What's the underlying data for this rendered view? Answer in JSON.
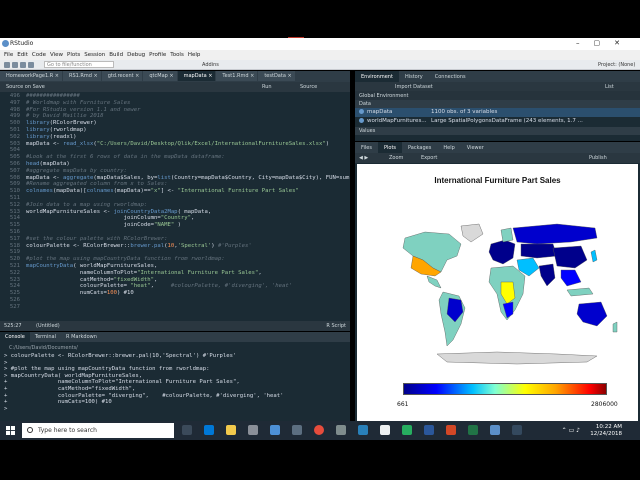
{
  "window": {
    "app_title": "RStudio"
  },
  "menu": [
    "File",
    "Edit",
    "Code",
    "View",
    "Plots",
    "Session",
    "Build",
    "Debug",
    "Profile",
    "Tools",
    "Help"
  ],
  "toolbar": {
    "goto_placeholder": "Go to file/function",
    "addins": "Addins",
    "project": "Project: (None)"
  },
  "editor": {
    "tabs": [
      "HomeworkPage1.R",
      "RS1.Rmd",
      "gtd.recent",
      "qtcMap",
      "mapData",
      "Test1.Rmd",
      "testData"
    ],
    "run_label": "Run",
    "source_label": "Source",
    "source_on_save": "Source on Save",
    "lines": [
      {
        "n": "496",
        "segs": [
          {
            "t": "################",
            "c": "c-comment"
          }
        ]
      },
      {
        "n": "497",
        "segs": [
          {
            "t": "# Worldmap with Furniture Sales",
            "c": "c-comment"
          }
        ]
      },
      {
        "n": "498",
        "segs": [
          {
            "t": "#For RStudio version 1.1 and newer",
            "c": "c-comment"
          }
        ]
      },
      {
        "n": "499",
        "segs": [
          {
            "t": "# by David Maillie 2018",
            "c": "c-comment"
          }
        ]
      },
      {
        "n": "500",
        "segs": [
          {
            "t": "library",
            "c": "c-fn"
          },
          {
            "t": "(RColorBrewer)",
            "c": "c-plain"
          }
        ]
      },
      {
        "n": "501",
        "segs": [
          {
            "t": "library",
            "c": "c-fn"
          },
          {
            "t": "(rworldmap)",
            "c": "c-plain"
          }
        ]
      },
      {
        "n": "502",
        "segs": [
          {
            "t": "library",
            "c": "c-fn"
          },
          {
            "t": "(readxl)",
            "c": "c-plain"
          }
        ]
      },
      {
        "n": "503",
        "segs": [
          {
            "t": "mapData <- ",
            "c": "c-plain"
          },
          {
            "t": "read_xlsx",
            "c": "c-fn"
          },
          {
            "t": "(",
            "c": "c-plain"
          },
          {
            "t": "\"C:/Users/David/Desktop/Qlik/Excel/InternationalFurnitureSales.xlsx\"",
            "c": "c-str"
          },
          {
            "t": ")",
            "c": "c-plain"
          }
        ]
      },
      {
        "n": "504",
        "segs": [
          {
            "t": "",
            "c": "c-plain"
          }
        ]
      },
      {
        "n": "505",
        "segs": [
          {
            "t": "#Look at the first 6 rows of data in the mapData dataframe:",
            "c": "c-comment"
          }
        ]
      },
      {
        "n": "506",
        "segs": [
          {
            "t": "head",
            "c": "c-fn"
          },
          {
            "t": "(mapData)",
            "c": "c-plain"
          }
        ]
      },
      {
        "n": "507",
        "segs": [
          {
            "t": "#aggregate mapData by country:",
            "c": "c-comment"
          }
        ]
      },
      {
        "n": "508",
        "segs": [
          {
            "t": "mapData <- ",
            "c": "c-plain"
          },
          {
            "t": "aggregate",
            "c": "c-fn"
          },
          {
            "t": "(mapData$Sales, by=",
            "c": "c-plain"
          },
          {
            "t": "list",
            "c": "c-fn"
          },
          {
            "t": "(Country=mapData$Country, City=mapData$City), FUN=sum)",
            "c": "c-plain"
          }
        ]
      },
      {
        "n": "509",
        "segs": [
          {
            "t": "#Rename aggregated column from x to Sales:",
            "c": "c-comment"
          }
        ]
      },
      {
        "n": "510",
        "segs": [
          {
            "t": "colnames",
            "c": "c-fn"
          },
          {
            "t": "(mapData)[",
            "c": "c-plain"
          },
          {
            "t": "colnames",
            "c": "c-fn"
          },
          {
            "t": "(mapData)==",
            "c": "c-plain"
          },
          {
            "t": "\"x\"",
            "c": "c-str"
          },
          {
            "t": "] <- ",
            "c": "c-plain"
          },
          {
            "t": "\"International Furniture Part Sales\"",
            "c": "c-str"
          }
        ]
      },
      {
        "n": "511",
        "segs": [
          {
            "t": "",
            "c": "c-plain"
          }
        ]
      },
      {
        "n": "512",
        "segs": [
          {
            "t": "#Join data to a map using rworldmap:",
            "c": "c-comment"
          }
        ]
      },
      {
        "n": "513",
        "segs": [
          {
            "t": "worldMapFurnitureSales <- ",
            "c": "c-plain"
          },
          {
            "t": "joinCountryData2Map",
            "c": "c-fn"
          },
          {
            "t": "( mapData,",
            "c": "c-plain"
          }
        ]
      },
      {
        "n": "514",
        "segs": [
          {
            "t": "                             joinColumn=",
            "c": "c-plain"
          },
          {
            "t": "\"Country\"",
            "c": "c-str"
          },
          {
            "t": ",",
            "c": "c-plain"
          }
        ]
      },
      {
        "n": "515",
        "segs": [
          {
            "t": "                             joinCode=",
            "c": "c-plain"
          },
          {
            "t": "\"NAME\"",
            "c": "c-str"
          },
          {
            "t": " )",
            "c": "c-plain"
          }
        ]
      },
      {
        "n": "516",
        "segs": [
          {
            "t": "",
            "c": "c-plain"
          }
        ]
      },
      {
        "n": "517",
        "segs": [
          {
            "t": "#set the colour palette with RColorBrewer:",
            "c": "c-comment"
          }
        ]
      },
      {
        "n": "518",
        "segs": [
          {
            "t": "colourPalette <- RColorBrewer::",
            "c": "c-plain"
          },
          {
            "t": "brewer.pal",
            "c": "c-fn"
          },
          {
            "t": "(",
            "c": "c-plain"
          },
          {
            "t": "10",
            "c": "c-num"
          },
          {
            "t": ",",
            "c": "c-plain"
          },
          {
            "t": "'Spectral'",
            "c": "c-str"
          },
          {
            "t": ") ",
            "c": "c-plain"
          },
          {
            "t": "#'Purples'",
            "c": "c-comment"
          }
        ]
      },
      {
        "n": "519",
        "segs": [
          {
            "t": "",
            "c": "c-plain"
          }
        ]
      },
      {
        "n": "520",
        "segs": [
          {
            "t": "#plot the map using mapCountryData function from rworldmap:",
            "c": "c-comment"
          }
        ]
      },
      {
        "n": "521",
        "segs": [
          {
            "t": "mapCountryData",
            "c": "c-fn"
          },
          {
            "t": "( worldMapFurnitureSales,",
            "c": "c-plain"
          }
        ]
      },
      {
        "n": "522",
        "segs": [
          {
            "t": "                nameColumnToPlot=",
            "c": "c-plain"
          },
          {
            "t": "\"International Furniture Part Sales\"",
            "c": "c-str"
          },
          {
            "t": ",",
            "c": "c-plain"
          }
        ]
      },
      {
        "n": "523",
        "segs": [
          {
            "t": "                catMethod=",
            "c": "c-plain"
          },
          {
            "t": "\"fixedWidth\"",
            "c": "c-str"
          },
          {
            "t": ",",
            "c": "c-plain"
          }
        ]
      },
      {
        "n": "524",
        "segs": [
          {
            "t": "                colourPalette= ",
            "c": "c-plain"
          },
          {
            "t": "\"heat\"",
            "c": "c-str"
          },
          {
            "t": ",     ",
            "c": "c-plain"
          },
          {
            "t": "#colourPalette, #'diverging', 'heat'",
            "c": "c-comment"
          }
        ]
      },
      {
        "n": "525",
        "segs": [
          {
            "t": "                numCats=",
            "c": "c-plain"
          },
          {
            "t": "100",
            "c": "c-num"
          },
          {
            "t": ") #10",
            "c": "c-plain"
          }
        ]
      },
      {
        "n": "526",
        "segs": [
          {
            "t": "",
            "c": "c-plain"
          }
        ]
      },
      {
        "n": "527",
        "segs": [
          {
            "t": "",
            "c": "c-plain"
          }
        ]
      }
    ],
    "status_pos": "525:27",
    "status_scope": "(Untitled)",
    "status_type": "R Script"
  },
  "console": {
    "tabs": [
      "Console",
      "Terminal",
      "R Markdown"
    ],
    "path": "C:/Users/David/Documents/",
    "lines": [
      "> colourPalette <- RColorBrewer::brewer.pal(10,'Spectral') #'Purples'",
      ">",
      "> #plot the map using mapCountryData function from rworldmap:",
      "> mapCountryData( worldMapFurnitureSales,",
      "+               nameColumnToPlot=\"International Furniture Part Sales\",",
      "+               catMethod=\"fixedWidth\",",
      "+               colourPalette= \"diverging\",    #colourPalette, #'diverging', 'heat'",
      "+               numCats=100) #10",
      ">"
    ]
  },
  "environment": {
    "tabs": [
      "Environment",
      "History",
      "Connections"
    ],
    "import_label": "Import Dataset",
    "list_label": "List",
    "scope": "Global Environment",
    "data_header": "Data",
    "values_header": "Values",
    "rows": [
      {
        "name": "mapData",
        "desc": "1100 obs. of 3 variables"
      },
      {
        "name": "worldMapFurnitures...",
        "desc": "Large SpatialPolygonsDataFrame (243 elements, 1.7 ..."
      }
    ]
  },
  "plots": {
    "tabs": [
      "Files",
      "Plots",
      "Packages",
      "Help",
      "Viewer"
    ],
    "zoom_label": "Zoom",
    "export_label": "Export",
    "publish_label": "Publish",
    "title": "International Furniture Part Sales",
    "legend_min": "661",
    "legend_max": "2806000"
  },
  "taskbar": {
    "search_placeholder": "Type here to search",
    "time": "10:22 AM",
    "date": "12/24/2018"
  },
  "colors": {
    "editor_bg": "#1b2b34",
    "comment": "#65737e",
    "function": "#6699cc",
    "string": "#99c794"
  }
}
